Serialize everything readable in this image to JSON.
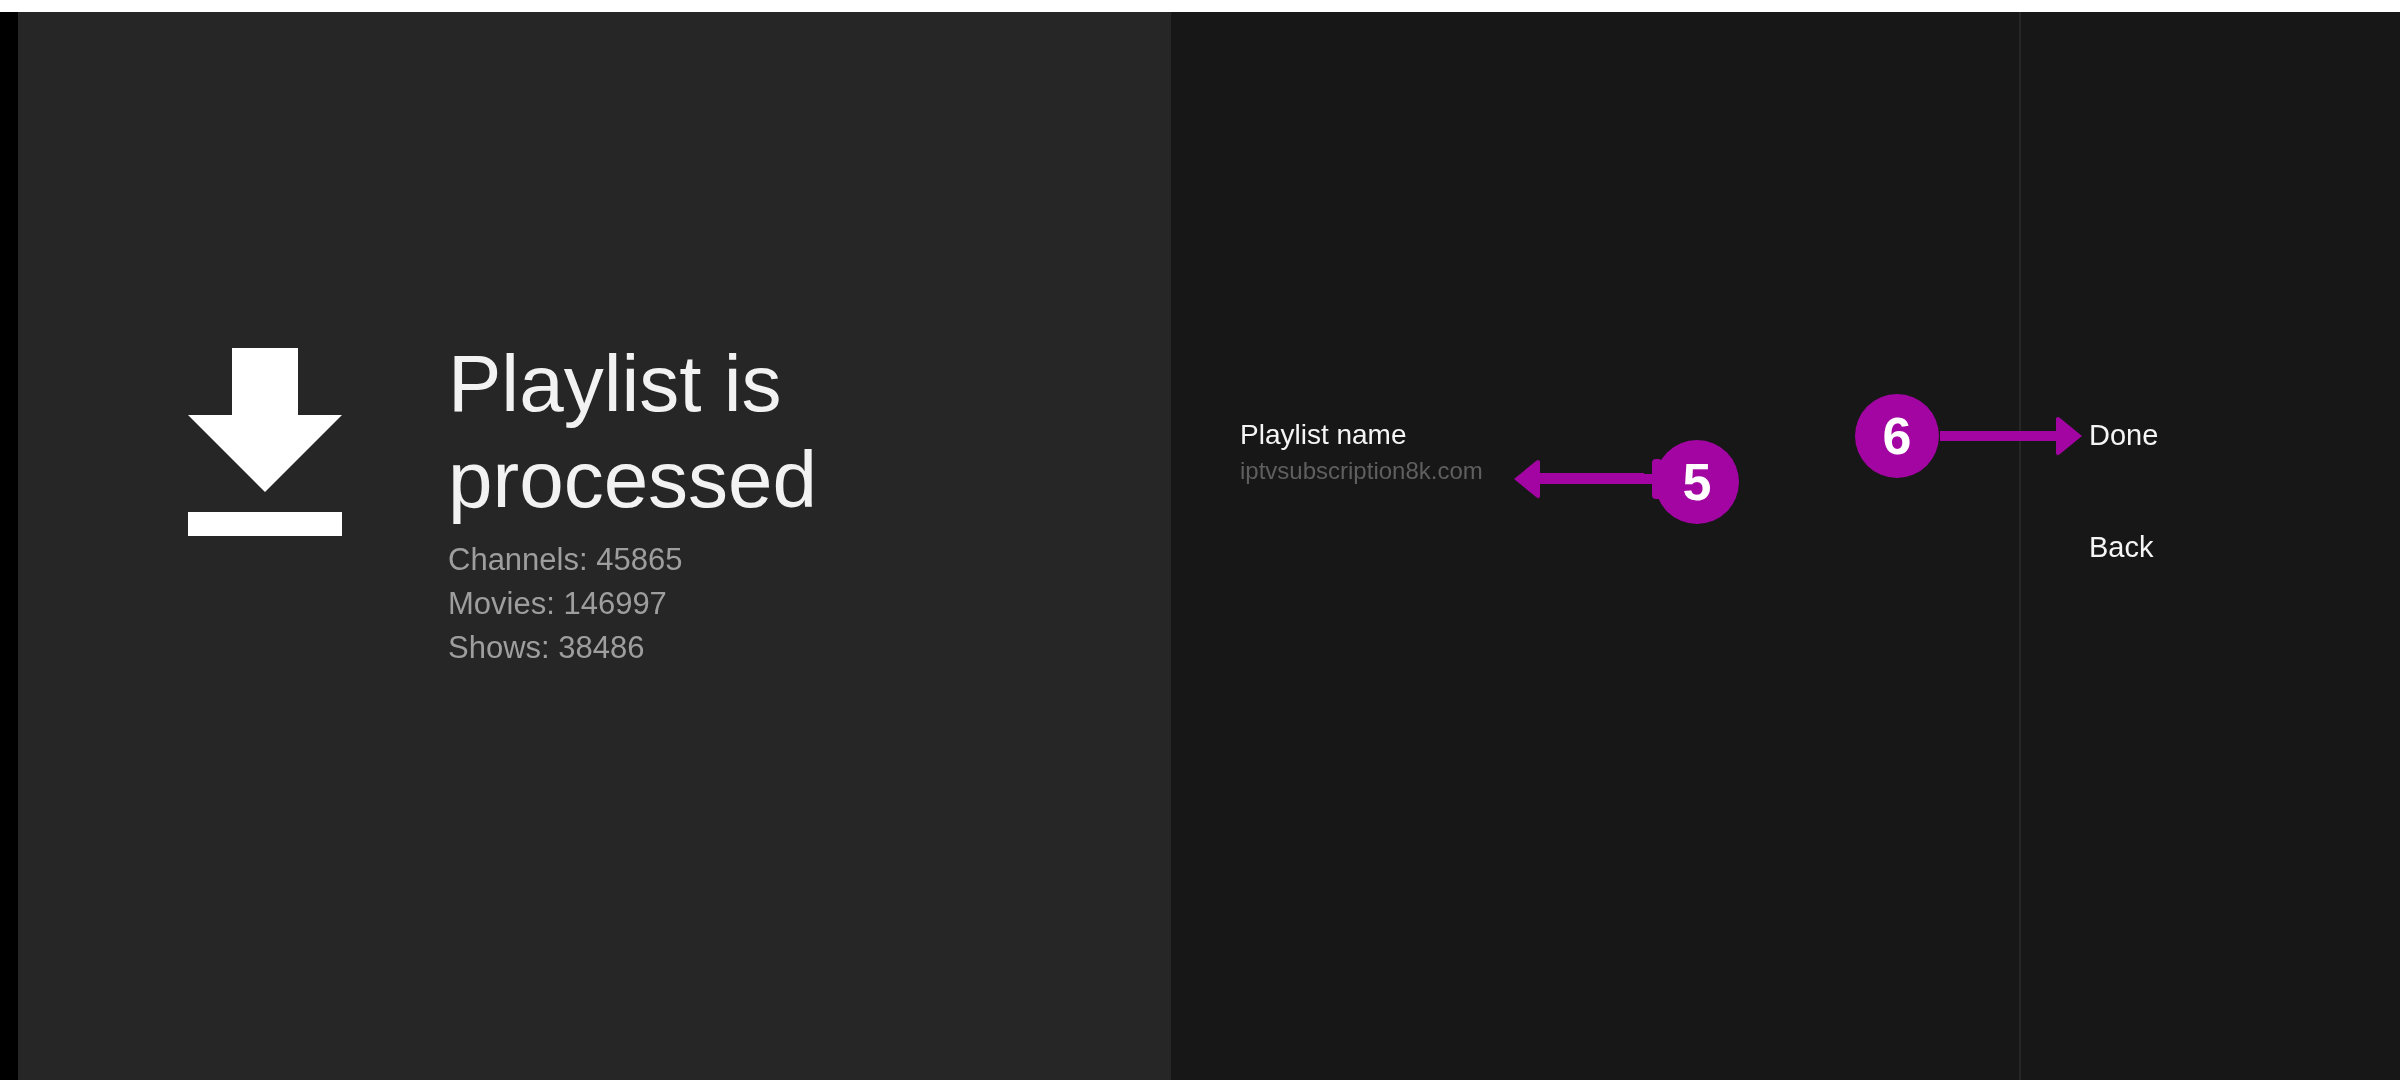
{
  "summary": {
    "title_lines": [
      "Playlist is",
      "processed"
    ],
    "stats": [
      "Channels: 45865",
      "Movies: 146997",
      "Shows: 38486"
    ]
  },
  "form": {
    "label": "Playlist name",
    "value": "iptvsubscription8k.com"
  },
  "actions": [
    {
      "label": "Done"
    },
    {
      "label": "Back"
    }
  ],
  "annotations": [
    {
      "label": "5",
      "kind": "point-left"
    },
    {
      "label": "6",
      "kind": "point-right"
    }
  ]
}
